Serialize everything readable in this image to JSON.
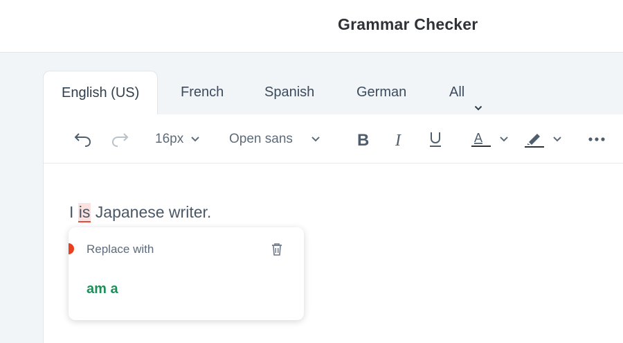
{
  "header": {
    "title": "Grammar Checker"
  },
  "tabs": [
    {
      "label": "English (US)",
      "active": true
    },
    {
      "label": "French"
    },
    {
      "label": "Spanish"
    },
    {
      "label": "German"
    },
    {
      "label": "All",
      "icon": "chevron-down-icon"
    }
  ],
  "toolbar": {
    "undo_icon": "undo-icon",
    "redo_icon": "redo-icon",
    "font_size": "16px",
    "font_family": "Open sans",
    "bold_icon": "bold-icon",
    "italic_icon": "italic-icon",
    "underline_icon": "underline-icon",
    "text_color_icon": "text-color-icon",
    "highlight_icon": "highlight-icon",
    "more_icon": "more-icon"
  },
  "document": {
    "before": "I ",
    "error_word": "is",
    "after": " Japanese writer."
  },
  "suggestion_popup": {
    "label": "Replace with",
    "replacement": "am a",
    "trash_icon": "trash-icon"
  },
  "colors": {
    "error": "#e8401e",
    "error_highlight": "#fbe2de",
    "suggestion": "#1f8f5a"
  }
}
